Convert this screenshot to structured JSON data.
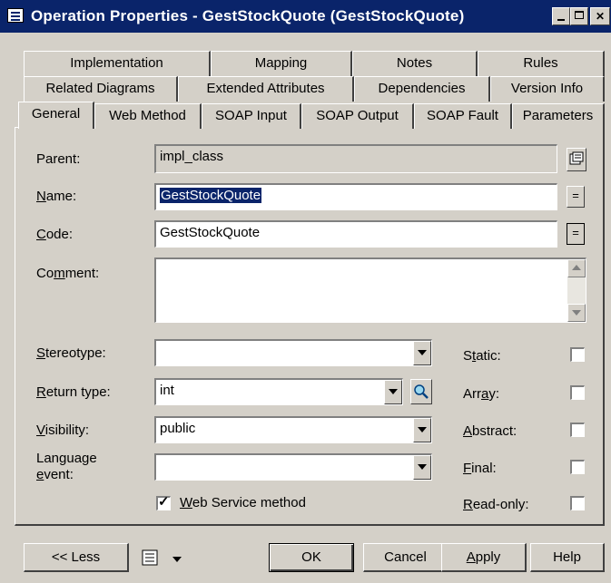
{
  "window": {
    "title": "Operation Properties - GestStockQuote (GestStockQuote)"
  },
  "tabs": {
    "row1": [
      "Implementation",
      "Mapping",
      "Notes",
      "Rules"
    ],
    "row2": [
      "Related Diagrams",
      "Extended Attributes",
      "Dependencies",
      "Version Info"
    ],
    "row3": [
      "General",
      "Web Method",
      "SOAP Input",
      "SOAP Output",
      "SOAP Fault",
      "Parameters"
    ]
  },
  "form": {
    "parent_label": "Parent:",
    "parent_value": "impl_class",
    "name_label": "Name:",
    "name_value": "GestStockQuote",
    "code_label": "Code:",
    "code_value": "GestStockQuote",
    "comment_label": "Comment:",
    "comment_value": "",
    "stereotype_label": "Stereotype:",
    "stereotype_value": "",
    "return_type_label": "Return type:",
    "return_type_value": "int",
    "visibility_label": "Visibility:",
    "visibility_value": "public",
    "language_event_label_1": "Language",
    "language_event_label_2": "event:",
    "language_event_value": "",
    "web_service_label": "Web Service method",
    "web_service_checked": true,
    "static_label": "Static:",
    "array_label": "Array:",
    "abstract_label": "Abstract:",
    "final_label": "Final:",
    "readonly_label": "Read-only:",
    "equals_glyph": "="
  },
  "buttons": {
    "less": "<< Less",
    "ok": "OK",
    "cancel": "Cancel",
    "apply": "Apply",
    "help": "Help"
  },
  "icons": {
    "window": "window-icon",
    "properties": "properties-icon",
    "browse": "magnifier-icon",
    "menu": "list-menu-icon"
  }
}
